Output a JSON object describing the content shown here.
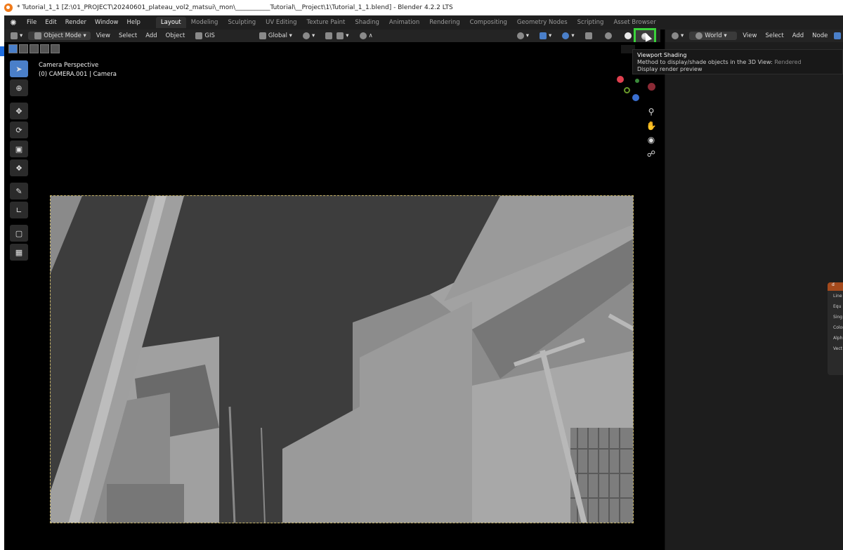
{
  "window": {
    "title": "* Tutorial_1_1 [Z:\\01_PROJECT\\20240601_plateau_vol2_matsui\\_mon\\___________Tutorial\\__Project\\1\\Tutorial_1_1.blend] - Blender 4.2.2 LTS"
  },
  "menu": [
    "File",
    "Edit",
    "Render",
    "Window",
    "Help"
  ],
  "workspaces": [
    {
      "label": "Layout",
      "active": true
    },
    {
      "label": "Modeling"
    },
    {
      "label": "Sculpting"
    },
    {
      "label": "UV Editing"
    },
    {
      "label": "Texture Paint"
    },
    {
      "label": "Shading"
    },
    {
      "label": "Animation"
    },
    {
      "label": "Rendering"
    },
    {
      "label": "Compositing"
    },
    {
      "label": "Geometry Nodes"
    },
    {
      "label": "Scripting"
    },
    {
      "label": "Asset Browser"
    }
  ],
  "viewport_header": {
    "mode": "Object Mode",
    "view": "View",
    "select": "Select",
    "add": "Add",
    "object": "Object",
    "gis": "GIS",
    "orientation": "Global"
  },
  "camera_info": {
    "perspective": "Camera Perspective",
    "object": "(0) CAMERA.001 | Camera"
  },
  "tooltip": {
    "title": "Viewport Shading",
    "description": "Method to display/shade objects in the 3D View:",
    "value": "Rendered",
    "detail": "Display render preview"
  },
  "right_header": {
    "world": "World",
    "view": "View",
    "select": "Select",
    "add": "Add",
    "node": "Node"
  },
  "node_fragment": {
    "header": "d",
    "rows": [
      "Line",
      "Equ",
      "Sing",
      "Color",
      "Alph",
      "Vect"
    ]
  },
  "toolbar_icons": [
    "select-box-icon",
    "cursor-icon",
    "move-icon",
    "rotate-icon",
    "scale-icon",
    "transform-icon",
    "annotate-icon",
    "measure-icon",
    "add-cube-icon",
    "add-object-icon"
  ],
  "nav_icons": [
    "zoom-icon",
    "hand-pan-icon",
    "camera-view-icon",
    "lock-icon"
  ]
}
